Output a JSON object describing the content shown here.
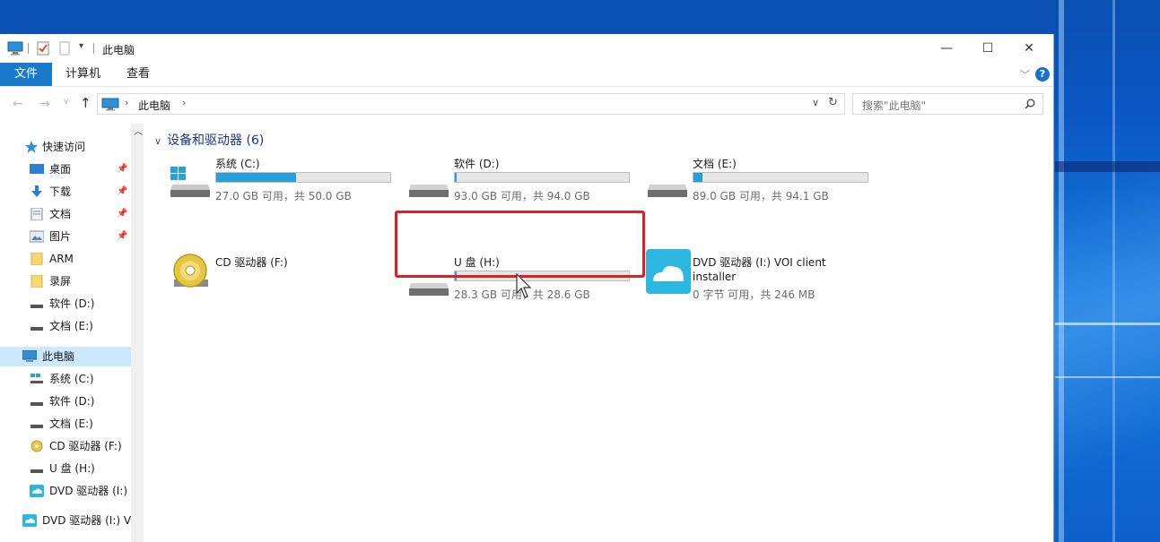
{
  "window": {
    "title": "此电脑",
    "minimize_label": "—",
    "maximize_label": "☐",
    "close_label": "✕"
  },
  "ribbon": {
    "tabs": [
      "文件",
      "计算机",
      "查看"
    ],
    "help_label": "?"
  },
  "address": {
    "path": [
      "此电脑"
    ],
    "search_placeholder": "搜索\"此电脑\""
  },
  "nav": {
    "quick_access": "快速访问",
    "quick_items": [
      {
        "label": "桌面",
        "icon": "desktop-icon",
        "pinned": true
      },
      {
        "label": "下载",
        "icon": "download-icon",
        "pinned": true
      },
      {
        "label": "文档",
        "icon": "documents-icon",
        "pinned": true
      },
      {
        "label": "图片",
        "icon": "pictures-icon",
        "pinned": true
      },
      {
        "label": "ARM",
        "icon": "folder-icon",
        "pinned": false
      },
      {
        "label": "录屏",
        "icon": "folder-icon",
        "pinned": false
      },
      {
        "label": "软件 (D:)",
        "icon": "drive-icon",
        "pinned": false
      },
      {
        "label": "文档 (E:)",
        "icon": "drive-icon",
        "pinned": false
      }
    ],
    "this_pc": "此电脑",
    "pc_items": [
      {
        "label": "系统 (C:)",
        "icon": "windows-drive-icon"
      },
      {
        "label": "软件 (D:)",
        "icon": "drive-icon"
      },
      {
        "label": "文档 (E:)",
        "icon": "drive-icon"
      },
      {
        "label": "CD 驱动器 (F:)",
        "icon": "cd-drive-icon"
      },
      {
        "label": "U 盘 (H:)",
        "icon": "drive-icon"
      },
      {
        "label": "DVD 驱动器 (I:)",
        "icon": "dvd-cloud-icon"
      }
    ],
    "bottom_item": "DVD 驱动器 (I:) V"
  },
  "content": {
    "group_header": "设备和驱动器 (6)",
    "drives": [
      {
        "name": "系统 (C:)",
        "info": "27.0 GB 可用，共 50.0 GB",
        "used_fraction": 0.46,
        "icon": "windows-drive-icon",
        "has_bar": true
      },
      {
        "name": "软件 (D:)",
        "info": "93.0 GB 可用，共 94.0 GB",
        "used_fraction": 0.01,
        "icon": "hdd-icon",
        "has_bar": true
      },
      {
        "name": "文档 (E:)",
        "info": "89.0 GB 可用，共 94.1 GB",
        "used_fraction": 0.05,
        "icon": "hdd-icon",
        "has_bar": true
      },
      {
        "name": "CD 驱动器 (F:)",
        "info": "",
        "used_fraction": 0,
        "icon": "cd-icon",
        "has_bar": false
      },
      {
        "name": "U 盘 (H:)",
        "info": "28.3 GB 可用，共 28.6 GB",
        "used_fraction": 0.01,
        "icon": "hdd-icon",
        "has_bar": true
      },
      {
        "name": "DVD 驱动器 (I:) VOI client",
        "name2": "installer",
        "info": "0 字节 可用，共 246 MB",
        "used_fraction": 1,
        "icon": "dvd-cloud-icon",
        "has_bar": false
      }
    ]
  },
  "colors": {
    "accent": "#1979ca",
    "progress": "#26a0da",
    "highlight": "#e41e1e"
  }
}
